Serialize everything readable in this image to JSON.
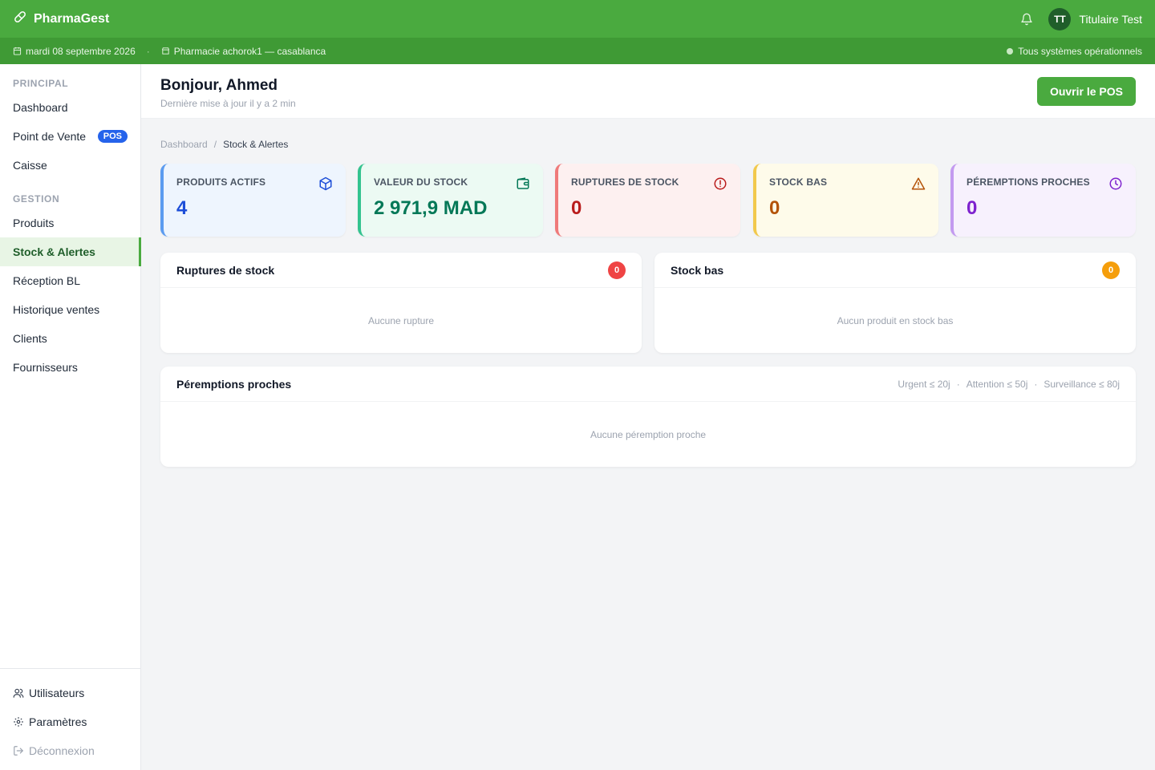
{
  "app": {
    "name": "PharmaGest",
    "user_initials": "TT",
    "user_name": "Titulaire Test"
  },
  "subbar": {
    "date": "mardi 08 septembre 2026",
    "pharmacy": "Pharmacie achorok1 — casablanca",
    "status": "Tous systèmes opérationnels"
  },
  "sidebar": {
    "section_principal": "PRINCIPAL",
    "principal_items": [
      {
        "label": "Dashboard"
      },
      {
        "label": "Point de Vente",
        "badge": "POS"
      },
      {
        "label": "Caisse"
      }
    ],
    "section_gestion": "GESTION",
    "gestion_items": [
      {
        "label": "Produits"
      },
      {
        "label": "Stock & Alertes"
      },
      {
        "label": "Réception BL"
      },
      {
        "label": "Historique ventes"
      },
      {
        "label": "Clients"
      },
      {
        "label": "Fournisseurs"
      }
    ],
    "bottom_items": [
      {
        "label": "Utilisateurs"
      },
      {
        "label": "Paramètres"
      },
      {
        "label": "Déconnexion"
      }
    ]
  },
  "header": {
    "greeting": "Bonjour, Ahmed",
    "updated": "Dernière mise à jour il y a 2 min",
    "pos_button": "Ouvrir le POS"
  },
  "breadcrumb": {
    "root": "Dashboard",
    "sep": "/",
    "current": "Stock & Alertes"
  },
  "stats": [
    {
      "label": "PRODUITS ACTIFS",
      "value": "4",
      "icon": "box-icon"
    },
    {
      "label": "VALEUR DU STOCK",
      "value": "2 971,9 MAD",
      "icon": "wallet-icon"
    },
    {
      "label": "RUPTURES DE STOCK",
      "value": "0",
      "icon": "alert-circle-icon"
    },
    {
      "label": "STOCK BAS",
      "value": "0",
      "icon": "warning-triangle-icon"
    },
    {
      "label": "PÉREMPTIONS PROCHES",
      "value": "0",
      "icon": "clock-icon"
    }
  ],
  "panels": {
    "ruptures": {
      "title": "Ruptures de stock",
      "count": "0",
      "empty": "Aucune rupture"
    },
    "stock_bas": {
      "title": "Stock bas",
      "count": "0",
      "empty": "Aucun produit en stock bas"
    },
    "peremptions": {
      "title": "Péremptions proches",
      "legend": [
        "Urgent ≤ 20j",
        "·",
        "Attention ≤ 50j",
        "·",
        "Surveillance ≤ 80j"
      ],
      "empty": "Aucune péremption proche"
    }
  },
  "colors": {
    "brand": "#4aaa3f",
    "brand_dark": "#3f9a35",
    "pos_badge": "#2563eb"
  }
}
